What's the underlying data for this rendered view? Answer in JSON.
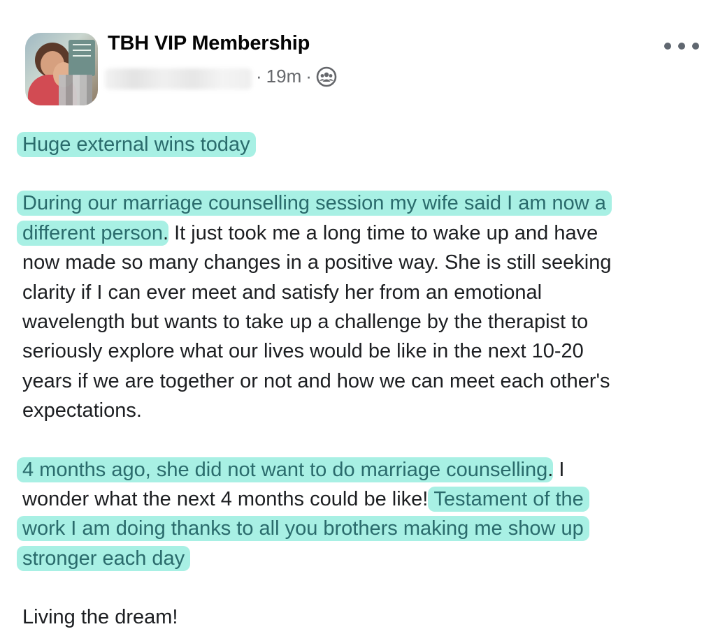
{
  "post": {
    "group_name": "TBH VIP Membership",
    "time": "19m",
    "separator": "·",
    "audience_icon": "group-icon",
    "more_icon": "more-options-icon",
    "highlight_color": "#a8f0e4",
    "highlight_text_color": "#2a6b6c",
    "p1": "Huge external wins today",
    "p2_highlight_1": "During our marriage counselling session my wife said I am now a",
    "p2_highlight_2": "different person",
    "p2_lines": [
      ". It just took me a long time to wake up and have",
      "now made so many changes in a positive way. She is still seeking",
      "clarity if I can ever meet and satisfy her from an emotional",
      "wavelength but wants to take up a challenge by the therapist to",
      "seriously explore what our lives would be like in the next 10-20",
      "years if we are together or not and how we can meet each other's",
      "expectations."
    ],
    "p3_highlight_1": "4 months ago, she did not want to do marriage counselling",
    "p3_text_1": ". I",
    "p3_text_2": "wonder what the next 4 months could be like! ",
    "p3_highlight_2": "Testament of the",
    "p3_highlight_3": "work I am doing thanks to all you brothers making me show up",
    "p3_highlight_4": "stronger each day",
    "p4": "Living the dream!"
  }
}
